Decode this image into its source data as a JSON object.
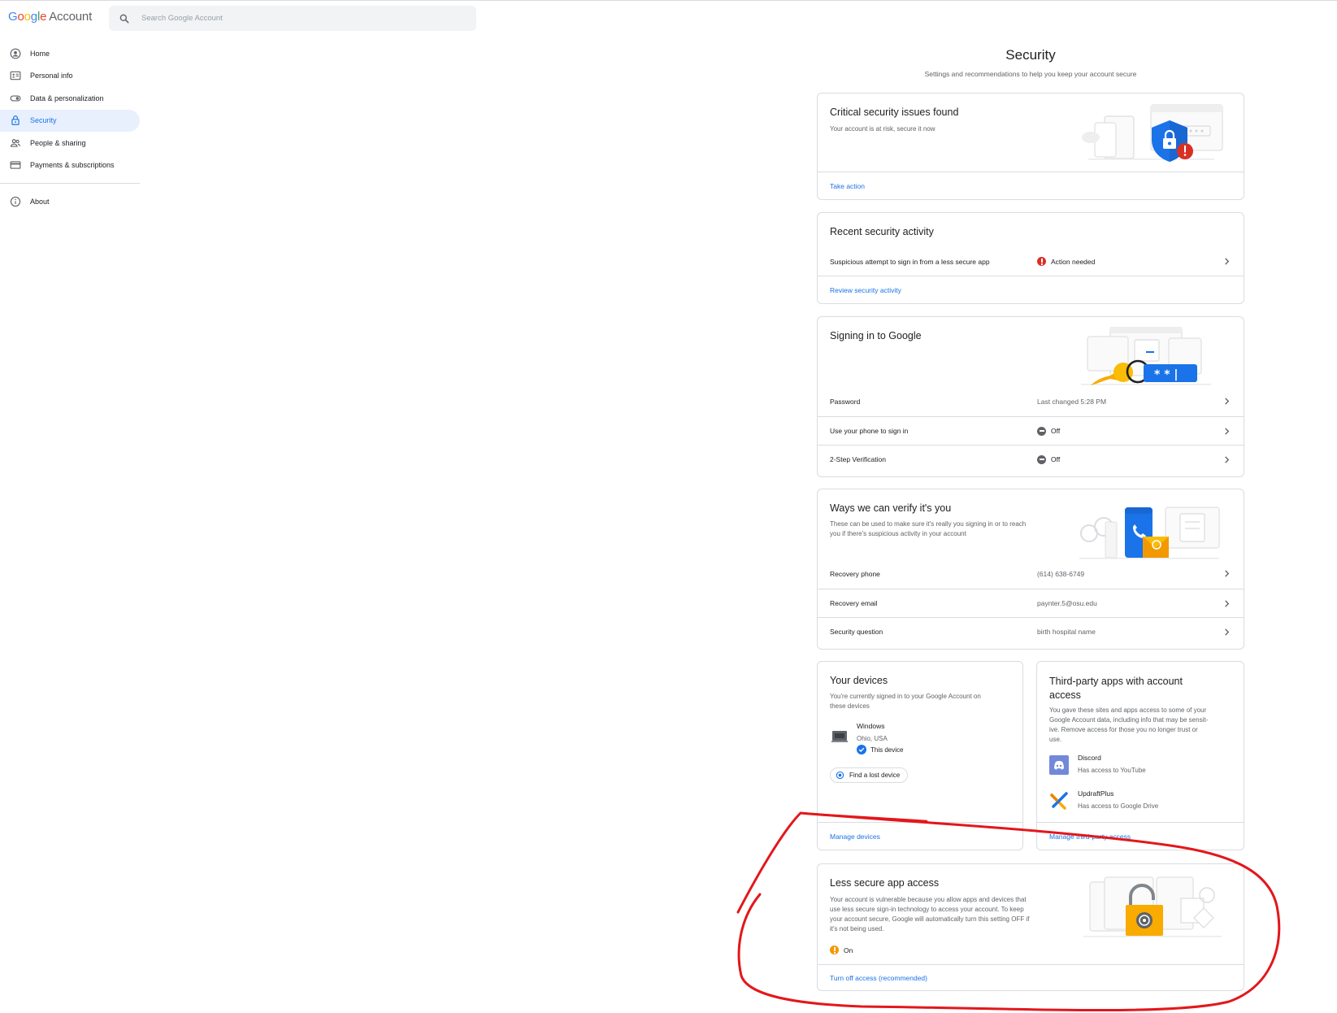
{
  "header": {
    "logo": {
      "g1": "G",
      "g2": "o",
      "g3": "o",
      "g4": "g",
      "g5": "l",
      "g6": "e",
      "account": "Account"
    },
    "search_placeholder": "Search Google Account"
  },
  "sidebar": {
    "items": [
      {
        "label": "Home",
        "icon": "home-icon"
      },
      {
        "label": "Personal info",
        "icon": "personal-info-icon"
      },
      {
        "label": "Data & personalization",
        "icon": "toggle-icon"
      },
      {
        "label": "Security",
        "icon": "lock-icon"
      },
      {
        "label": "People & sharing",
        "icon": "people-icon"
      },
      {
        "label": "Payments & subscriptions",
        "icon": "credit-card-icon"
      }
    ],
    "about": {
      "label": "About",
      "icon": "info-icon"
    },
    "active": "Security"
  },
  "page": {
    "title": "Security",
    "subtitle": "Settings and recommendations to help you keep your account secure"
  },
  "critical": {
    "title": "Critical security issues found",
    "desc": "Your account is at risk, secure it now",
    "link": "Take action"
  },
  "recent": {
    "title": "Recent security activity",
    "row_label": "Suspicious attempt to sign in from a less secure app",
    "row_status": "Action needed",
    "link": "Review security activity"
  },
  "signin": {
    "title": "Signing in to Google",
    "rows": [
      {
        "label": "Password",
        "value": "Last changed 5:28 PM"
      },
      {
        "label": "Use your phone to sign in",
        "value": "Off"
      },
      {
        "label": "2-Step Verification",
        "value": "Off"
      }
    ]
  },
  "verify": {
    "title": "Ways we can verify it's you",
    "desc_line1": "These can be used to make sure it's really you signing in or to reach",
    "desc_line2": "you if there's suspicious activity in your account",
    "rows": [
      {
        "label": "Recovery phone",
        "value": "(614) 638-6749"
      },
      {
        "label": "Recovery email",
        "value": "paynter.5@osu.edu"
      },
      {
        "label": "Security question",
        "value": "birth hospital name"
      }
    ]
  },
  "devices": {
    "title": "Your devices",
    "desc_line1": "You're currently signed in to your Google Account on",
    "desc_line2": "these devices",
    "device_name": "Windows",
    "device_location": "Ohio, USA",
    "device_this": "This device",
    "find_button": "Find a lost device",
    "link": "Manage devices"
  },
  "thirdparty": {
    "title_line1": "Third-party apps with account",
    "title_line2": "access",
    "desc_line1": "You gave these sites and apps access to some of your",
    "desc_line2": "Google Account data, including info that may be sensit-",
    "desc_line3": "ive. Remove access for those you no longer trust or",
    "desc_line4": "use.",
    "apps": [
      {
        "name": "Discord",
        "access": "Has access to YouTube",
        "icon": "discord-icon"
      },
      {
        "name": "UpdraftPlus",
        "access": "Has access to Google Drive",
        "icon": "updraftplus-icon"
      }
    ],
    "link": "Manage third-party access"
  },
  "lesssecure": {
    "title": "Less secure app access",
    "desc_line1": "Your account is vulnerable because you allow apps and devices that",
    "desc_line2": "use less secure sign-in technology to access your account. To keep",
    "desc_line3": "your account secure, Google will automatically turn this setting OFF if",
    "desc_line4": "it's not being used.",
    "status": "On",
    "link": "Turn off access (recommended)"
  },
  "colors": {
    "accent": "#1a73e8",
    "active_bg": "#e8f0fe",
    "error": "#d93025",
    "warning": "#f29900",
    "annotation": "#e3171b"
  }
}
